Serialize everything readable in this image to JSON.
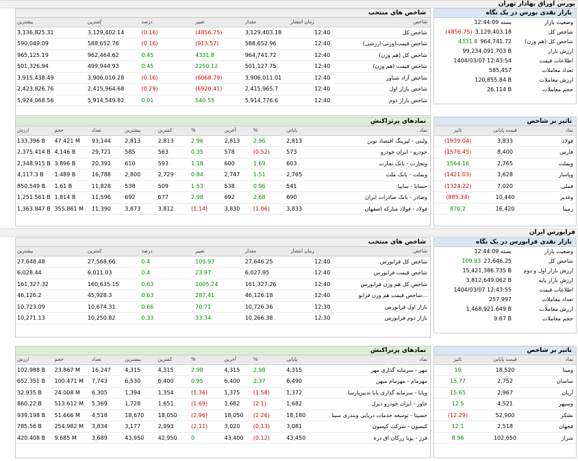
{
  "tehran": {
    "title": "بورس اوراق بهادار تهران",
    "liquidity": {
      "title": "بازار نقدی بورس در یک نگاه",
      "rows": [
        {
          "label": "وضعیت بازار",
          "value": "بسته 12:44:09",
          "change": "",
          "dir": ""
        },
        {
          "label": "شاخص کل",
          "value": "3,129,403.18",
          "change": "(4856.75)",
          "dir": "neg"
        },
        {
          "label": "شاخص کل (هم وزن)",
          "value": "964,741.72",
          "change": "4331.8",
          "dir": "pos"
        },
        {
          "label": "ارزش بازار",
          "value": "99,234,091.703 B",
          "change": "",
          "dir": ""
        },
        {
          "label": "اطلاعات قیمت",
          "value": "1404/03/07 12:43:54",
          "change": "",
          "dir": ""
        },
        {
          "label": "تعداد معاملات",
          "value": "585,457",
          "change": "",
          "dir": ""
        },
        {
          "label": "ارزش معاملات",
          "value": "120,855.84 B",
          "change": "",
          "dir": ""
        },
        {
          "label": "حجم معاملات",
          "value": "26.114 B",
          "change": "",
          "dir": ""
        }
      ]
    },
    "indices": {
      "title": "شاخص های منتخب",
      "headers": [
        "شاخص",
        "زمان انتشار",
        "مقدار",
        "تغییر",
        "درصد",
        "کمترین",
        "بیشترین"
      ],
      "rows": [
        {
          "name": "شاخص کل",
          "time": "12:40",
          "value": "3,129,403.18",
          "change": "(4856.75)",
          "pct": "(0.16)",
          "low": "3,129,402.14",
          "high": "3,136,825.31",
          "dir": "neg"
        },
        {
          "name": "شاخص قیمت(وزنی-ارزشی)",
          "time": "12:40",
          "value": "588,652.96",
          "change": "(913.57)",
          "pct": "(0.16)",
          "low": "588,652.76",
          "high": "590,049.09",
          "dir": "neg"
        },
        {
          "name": "شاخص کل (هم وزن)",
          "time": "12:40",
          "value": "964,741.72",
          "change": "4331.8",
          "pct": "0.45",
          "low": "962,464.62",
          "high": "965,125.19",
          "dir": "pos"
        },
        {
          "name": "شاخص قیمت (هم وزن)",
          "time": "12:40",
          "value": "501,127.75",
          "change": "2250.12",
          "pct": "0.45",
          "low": "499,944.93",
          "high": "501,326.94",
          "dir": "pos"
        },
        {
          "name": "شاخص آزاد شناور",
          "time": "12:40",
          "value": "3,906,011.01",
          "change": "(6068.79)",
          "pct": "(0.16)",
          "low": "3,906,010.28",
          "high": "3,915,438.49",
          "dir": "neg"
        },
        {
          "name": "شاخص بازار اول",
          "time": "12:40",
          "value": "2,415,965.7",
          "change": "(6920.41)",
          "pct": "(0.29)",
          "low": "2,415,964.68",
          "high": "2,423,826.76",
          "dir": "neg"
        },
        {
          "name": "شاخص بازار دوم",
          "time": "12:40",
          "value": "5,914,776.6",
          "change": "540.55",
          "pct": "0.01",
          "low": "5,914,549.82",
          "high": "5,924,068.56",
          "dir": "pos"
        }
      ]
    },
    "impact": {
      "title": "تاثیر بر شاخص",
      "headers": [
        "نماد",
        "قیمت پایانی",
        "تاثیر"
      ],
      "rows": [
        {
          "symbol": "فولاد",
          "price": "3,833",
          "impact": "(1939.04)",
          "dir": "neg"
        },
        {
          "symbol": "فارس",
          "price": "8,400",
          "impact": "(1576.45)",
          "dir": "neg"
        },
        {
          "symbol": "وبملت",
          "price": "2,765",
          "impact": "1564.16",
          "dir": "pos"
        },
        {
          "symbol": "وپاسار",
          "price": "3,628",
          "impact": "(1421.03)",
          "dir": "neg"
        },
        {
          "symbol": "فملی",
          "price": "7,020",
          "impact": "(1324.22)",
          "dir": "neg"
        },
        {
          "symbol": "وغدیر",
          "price": "10,440",
          "impact": "(885.34)",
          "dir": "neg"
        },
        {
          "symbol": "رمپنا",
          "price": "16,420",
          "impact": "870.2",
          "dir": "pos"
        }
      ]
    },
    "symbols": {
      "title": "نمادهای پرتراکنش",
      "headers": [
        "نماد",
        "پایانی",
        "%",
        "آخرین",
        "%",
        "کمترین",
        "بیشترین",
        "تعداد",
        "حجم",
        "ارزش"
      ],
      "rows": [
        {
          "name": "ولبنی - لیزینگ اقتصاد نوین",
          "close": "2,813",
          "cpct": "2.96",
          "last": "2,813",
          "lpct": "2.96",
          "low": "2,813",
          "high": "2,813",
          "count": "93,144",
          "vol": "47.421 M",
          "val": "133.396 B",
          "cdir": "pos",
          "ldir": "pos"
        },
        {
          "name": "خودرو - ایران خودرو",
          "close": "573",
          "cpct": "(0.52)",
          "last": "578",
          "lpct": "0.35",
          "low": "563",
          "high": "585",
          "count": "29,721",
          "vol": "4.146 B",
          "val": "2,375.414 B",
          "cdir": "neg",
          "ldir": "pos"
        },
        {
          "name": "وتجارت - بانک تجارت",
          "close": "603",
          "cpct": "1.69",
          "last": "600",
          "lpct": "1.18",
          "low": "593",
          "high": "610",
          "count": "20,391",
          "vol": "3.896 B",
          "val": "2,348.915 B",
          "cdir": "pos",
          "ldir": "pos"
        },
        {
          "name": "وبملت - بانک ملت",
          "close": "2,765",
          "cpct": "1.51",
          "last": "2,747",
          "lpct": "0.84",
          "low": "2,729",
          "high": "2,800",
          "count": "16,788",
          "vol": "1.489 B",
          "val": "4,117.3 B",
          "cdir": "pos",
          "ldir": "pos"
        },
        {
          "name": "حسایا - سایپا",
          "close": "541",
          "cpct": "0.96",
          "last": "538",
          "lpct": "1.53",
          "low": "509",
          "high": "538",
          "count": "11,828",
          "vol": "1.61 B",
          "val": "850.549 B",
          "cdir": "pos",
          "ldir": "pos"
        },
        {
          "name": "وصادر - بانک صادرات ایران",
          "close": "690",
          "cpct": "2.68",
          "last": "692",
          "lpct": "2.98",
          "low": "677",
          "high": "692",
          "count": "11,596",
          "vol": "1.814 B",
          "val": "1,251.561 B",
          "cdir": "pos",
          "ldir": "pos"
        },
        {
          "name": "فولاد - فولاد مبارکه اصفهان",
          "close": "3,833",
          "cpct": "(1.06)",
          "last": "3,830",
          "lpct": "(1.14)",
          "low": "3,812",
          "high": "3,873",
          "count": "11,390",
          "vol": "355.861 M",
          "val": "1,363.847 B",
          "cdir": "neg",
          "ldir": "neg"
        }
      ]
    }
  },
  "farabourse": {
    "title": "فرابورس ایران",
    "liquidity": {
      "title": "بازار نقدی فرابورس در یک نگاه",
      "rows": [
        {
          "label": "وضعیت بازار",
          "value": "بسته 12:44:09",
          "change": "",
          "dir": ""
        },
        {
          "label": "شاخص کل",
          "value": "27,646.25",
          "change": "109.93",
          "dir": "pos"
        },
        {
          "label": "ارزش بازار اول و دوم",
          "value": "15,421,386.735 B",
          "change": "",
          "dir": ""
        },
        {
          "label": "ارزش بازار پایه",
          "value": "3,812,649.062 B",
          "change": "",
          "dir": ""
        },
        {
          "label": "اطلاعات قیمت",
          "value": "1404/03/07 12:43:55",
          "change": "",
          "dir": ""
        },
        {
          "label": "تعداد معاملات",
          "value": "257,997",
          "change": "",
          "dir": ""
        },
        {
          "label": "ارزش معاملات",
          "value": "1,468,921.649 B",
          "change": "",
          "dir": ""
        },
        {
          "label": "حجم معاملات",
          "value": "9.67 B",
          "change": "",
          "dir": ""
        }
      ]
    },
    "indices": {
      "title": "شاخص های منتخب",
      "headers": [
        "شاخص",
        "زمان انتشار",
        "مقدار",
        "تغییر",
        "درصد",
        "کمترین",
        "بیشترین"
      ],
      "rows": [
        {
          "name": "شاخص کل فرابورس",
          "time": "12:40",
          "value": "27,646.25",
          "change": "109.93",
          "pct": "0.4",
          "low": "27,568.66",
          "high": "27,648.48",
          "dir": "pos"
        },
        {
          "name": "شاخص قیمت فرابورس",
          "time": "12:40",
          "value": "6,027.95",
          "change": "23.97",
          "pct": "0.4",
          "low": "6,011.03",
          "high": "6,028.44",
          "dir": "pos"
        },
        {
          "name": "شاخص کل هم وزن فرابورس",
          "time": "12:40",
          "value": "161,327.26",
          "change": "1005.24",
          "pct": "0.63",
          "low": "160,635.15",
          "high": "161,327.32",
          "dir": "pos"
        },
        {
          "name": "شاخص قیمت هم وزن فرابو...",
          "time": "12:40",
          "value": "46,126.18",
          "change": "287.41",
          "pct": "0.63",
          "low": "45,928.3",
          "high": "46,126.2",
          "dir": "pos"
        },
        {
          "name": "بازار اول فرابورس",
          "time": "12:30",
          "value": "10,726.36",
          "change": "70.71",
          "pct": "0.66",
          "low": "10,674.31",
          "high": "10,723.09",
          "dir": "pos"
        },
        {
          "name": "بازار دوم فرابورس",
          "time": "12:30",
          "value": "10,266.38",
          "change": "33.34",
          "pct": "0.33",
          "low": "10,250.82",
          "high": "10,271.13",
          "dir": "pos"
        }
      ]
    },
    "impact": {
      "title": "تاثیر بر شاخص",
      "headers": [
        "نماد",
        "قیمت پایانی",
        "تاثیر"
      ],
      "rows": [
        {
          "symbol": "ومینا",
          "price": "18,520",
          "impact": "19",
          "dir": "pos"
        },
        {
          "symbol": "ساسان",
          "price": "2,752",
          "impact": "15.77",
          "dir": "pos"
        },
        {
          "symbol": "آریان",
          "price": "2,967",
          "impact": "15.65",
          "dir": "pos"
        },
        {
          "symbol": "وسپهر",
          "price": "4,521",
          "impact": "12.5",
          "dir": "pos"
        },
        {
          "symbol": "نشکر",
          "price": "52,900",
          "impact": "(12.29)",
          "dir": "neg"
        },
        {
          "symbol": "فجهان",
          "price": "2,518",
          "impact": "12.1",
          "dir": "pos"
        },
        {
          "symbol": "شراز",
          "price": "102,650",
          "impact": "8.96",
          "dir": "pos"
        }
      ]
    },
    "symbols": {
      "title": "نمادهای پرتراکنش",
      "headers": [
        "نماد",
        "پایانی",
        "%",
        "آخرین",
        "%",
        "کمترین",
        "بیشترین",
        "تعداد",
        "حجم",
        "ارزش"
      ],
      "rows": [
        {
          "name": "مهر - سرمایه گذاری مهر",
          "close": "4,315",
          "cpct": "2.98",
          "last": "4,315",
          "lpct": "2.98",
          "low": "4,315",
          "high": "4,315",
          "count": "16,247",
          "vol": "23.867 M",
          "val": "102.988 B",
          "cdir": "pos",
          "ldir": "pos"
        },
        {
          "name": "مهرمام - مهرمام میهن",
          "close": "6,490",
          "cpct": "2.37",
          "last": "6,400",
          "lpct": "0.95",
          "low": "6,400",
          "high": "6,530",
          "count": "7,743",
          "vol": "100.471 M",
          "val": "652.351 B",
          "cdir": "pos",
          "ldir": "pos"
        },
        {
          "name": "وپایا - سرمایه گذاری پایا تدبیرپارسا",
          "close": "1,372",
          "cpct": "(1.58)",
          "last": "1,375",
          "lpct": "(1.36)",
          "low": "1,354",
          "high": "1,394",
          "count": "6,305",
          "vol": "24.008 M",
          "val": "32.935 B",
          "cdir": "neg",
          "ldir": "neg"
        },
        {
          "name": "خاور - ایران خودرو دیزل",
          "close": "1,682",
          "cpct": "(2.1)",
          "last": "1,682",
          "lpct": "(1.69)",
          "low": "1,651",
          "high": "1,728",
          "count": "5,369",
          "vol": "513.612 M",
          "val": "860.22 B",
          "cdir": "neg",
          "ldir": "neg"
        },
        {
          "name": "حسینا - توسعه خدمات دریایی وبندری سینا",
          "close": "18,180",
          "cpct": "(2.26)",
          "last": "18,050",
          "lpct": "(2.96)",
          "low": "18,050",
          "high": "18,670",
          "count": "4,518",
          "vol": "51.666 M",
          "val": "939.198 B",
          "cdir": "neg",
          "ldir": "neg"
        },
        {
          "name": "کیسون - شرکت کیسون",
          "close": "3,081",
          "cpct": "(0.13)",
          "last": "3,020",
          "lpct": "(2.11)",
          "low": "2,993",
          "high": "3,177",
          "count": "3,834",
          "vol": "254.982 M",
          "val": "785.56 B",
          "cdir": "neg",
          "ldir": "neg"
        },
        {
          "name": "فرز - پویا زرکان اق دره",
          "close": "43,450",
          "cpct": "(0.12)",
          "last": "43,400",
          "lpct": "0",
          "low": "42,950",
          "high": "43,950",
          "count": "3,689",
          "vol": "9.685 M",
          "val": "420.408 B",
          "cdir": "neg",
          "ldir": "pos"
        }
      ]
    }
  }
}
